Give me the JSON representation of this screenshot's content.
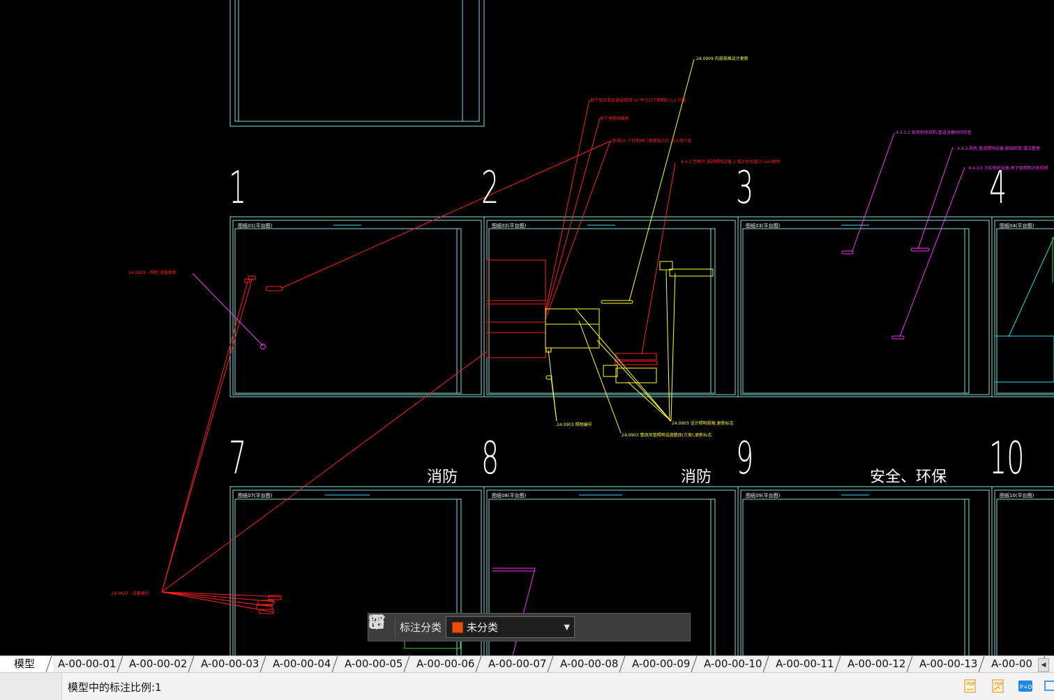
{
  "canvas": {
    "grid_numbers": [
      "1",
      "2",
      "3",
      "4",
      "7",
      "8",
      "9",
      "10"
    ],
    "section_labels": [
      "消防",
      "消防",
      "安全、环保"
    ],
    "frame_titles": [
      "图纸01(平台图)",
      "图纸02(平台图)",
      "图纸03(平台图)",
      "图纸04(平台图)",
      "图纸07(平台图)",
      "图纸08(平台图)",
      "图纸09(平台图)",
      "图纸10(平台图)"
    ],
    "annotations": {
      "a1": "24.0909 内部规格设计更新",
      "a2": "地下室及电缆通道照明 50 平方以下照明灯入3 号楼",
      "a3": "地下室照明更新",
      "a4": "新增10 个控制阀门更换指示灯,进入电气室",
      "a5": "4.4.3 生物计,排除照明设备,2 楼计划检查(3.5m)更新",
      "a6": "4.3.1.2 现场机房结构,管道设备时间检查",
      "a7": "4.4.2.风机,管道照明设备,配线检修,清洁整理",
      "a8": "4.4.3.5 冷却系统设备,地下室照明计划检修",
      "a9": "24.0828 - 照明,设备更新",
      "a10": "24.0903 照明编号",
      "a11": "24.0903 设计照明规格,更新标志",
      "a12": "24.0903 整改风管照明设施整改(方案),更新标志",
      "a13": "24.0827 - 设备编号"
    }
  },
  "toolbar": {
    "label": "标注分类",
    "select_value": "未分类",
    "select_swatch_color": "#e8500a",
    "icons": [
      "grid-icon",
      "edit-icon",
      "move-icon",
      "copy-icon",
      "paste-icon"
    ]
  },
  "tabs": {
    "model": "模型",
    "layouts": [
      "A-00-00-01",
      "A-00-00-02",
      "A-00-00-03",
      "A-00-00-04",
      "A-00-00-05",
      "A-00-00-06",
      "A-00-00-07",
      "A-00-00-08",
      "A-00-00-09",
      "A-00-00-10",
      "A-00-00-11",
      "A-00-00-12",
      "A-00-00-13",
      "A-00-00"
    ]
  },
  "status": {
    "text": "模型中的标注比例:1"
  },
  "colors": {
    "canvas_bg": "#000000",
    "frame": "#7fe0e0",
    "red_markup": "#ff2020",
    "yellow_markup": "#ffff30",
    "magenta_markup": "#ff30ff"
  }
}
